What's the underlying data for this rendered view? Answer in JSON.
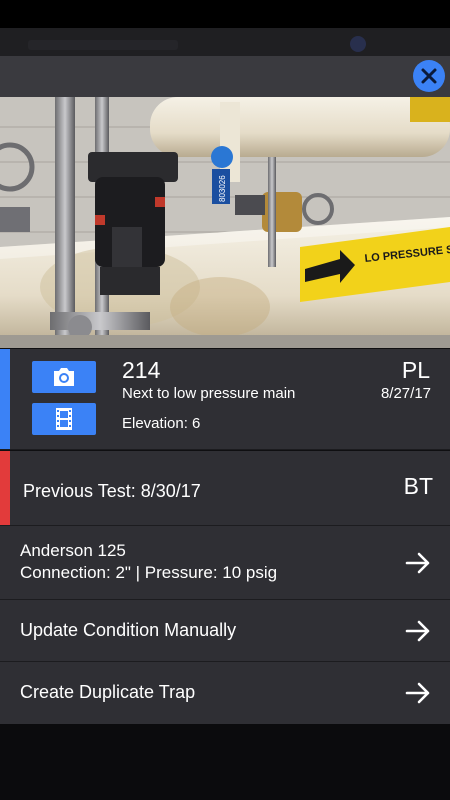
{
  "header": {
    "close_icon": "close-icon"
  },
  "trap": {
    "number": "214",
    "location": "Next to low pressure main",
    "elevation": "Elevation: 6",
    "code": "PL",
    "date": "8/27/17",
    "camera_icon": "camera-icon",
    "film_icon": "film-icon",
    "accent_color": "#3b82f6"
  },
  "previous_test": {
    "label": "Previous Test: 8/30/17",
    "code": "BT",
    "accent_color": "#e23b3b"
  },
  "details": {
    "model": "Anderson 125",
    "spec": "Connection: 2\" | Pressure: 10 psig"
  },
  "actions": [
    {
      "label": "Update Condition Manually"
    },
    {
      "label": "Create Duplicate Trap"
    }
  ],
  "photo_tag_text": "LO PRESSURE STEAM",
  "photo_tag_number": "803026"
}
